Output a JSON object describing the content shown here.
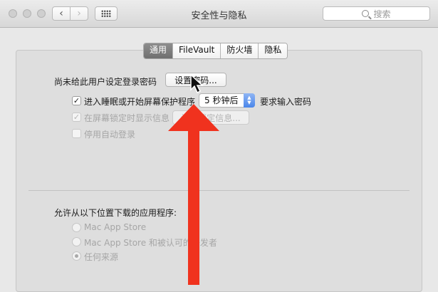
{
  "window": {
    "title": "安全性与隐私"
  },
  "toolbar": {
    "back_icon": "chevron-left-icon",
    "forward_icon": "chevron-right-icon",
    "show_all_icon": "grid-icon",
    "search_placeholder": "搜索"
  },
  "tabs": [
    {
      "label": "通用",
      "active": true
    },
    {
      "label": "FileVault",
      "active": false
    },
    {
      "label": "防火墙",
      "active": false
    },
    {
      "label": "隐私",
      "active": false
    }
  ],
  "general": {
    "no_password_label": "尚未给此用户设定登录密码",
    "set_password_button": "设置密码...",
    "require_password": {
      "label": "进入睡眠或开始屏幕保护程序",
      "checked": true,
      "delay_value": "5 秒钟后",
      "suffix": "要求输入密码"
    },
    "show_message": {
      "label": "在屏幕锁定时显示信息",
      "checked": true,
      "enabled": false,
      "button": "设置锁定信息..."
    },
    "disable_autologin": {
      "label": "停用自动登录",
      "checked": false,
      "enabled": false
    }
  },
  "downloads": {
    "heading": "允许从以下位置下载的应用程序:",
    "options": [
      {
        "label": "Mac App Store",
        "selected": false
      },
      {
        "label": "Mac App Store 和被认可的开发者",
        "selected": false
      },
      {
        "label": "任何来源",
        "selected": true
      }
    ]
  },
  "annotation": {
    "arrow_color": "#f0321e"
  }
}
